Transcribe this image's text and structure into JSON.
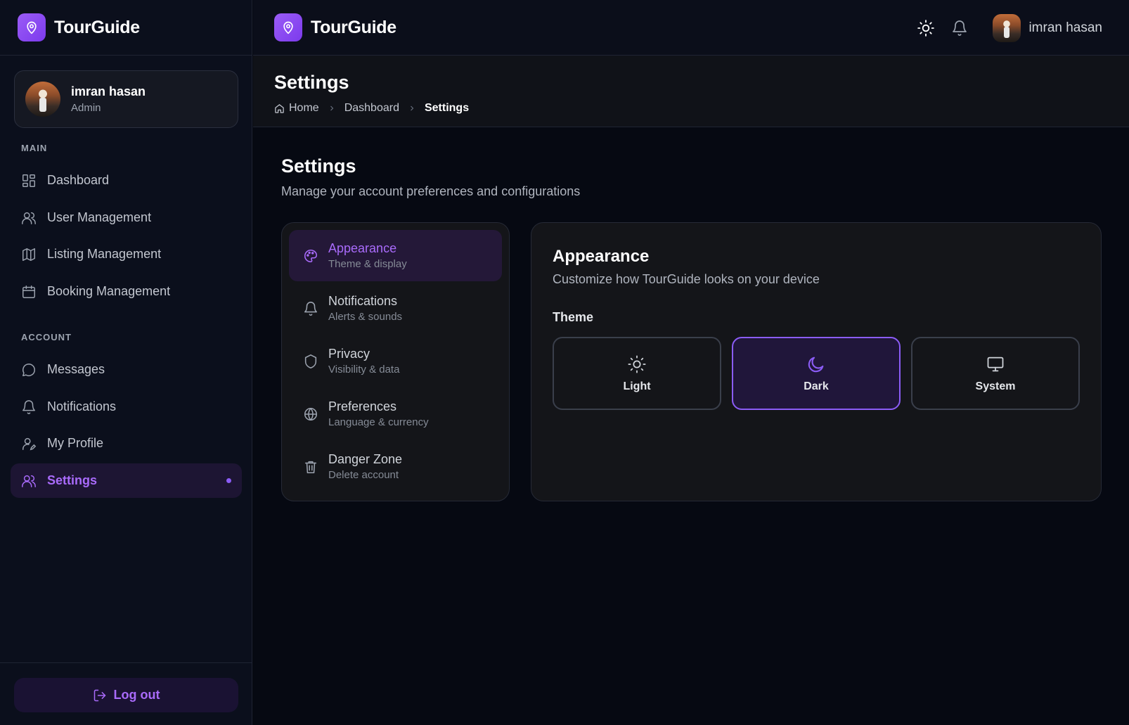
{
  "app": {
    "name": "TourGuide"
  },
  "user": {
    "name": "imran hasan",
    "role": "Admin"
  },
  "sidebar": {
    "main_label": "MAIN",
    "main_items": [
      {
        "label": "Dashboard",
        "icon": "grid-icon"
      },
      {
        "label": "User Management",
        "icon": "users-icon"
      },
      {
        "label": "Listing Management",
        "icon": "map-icon"
      },
      {
        "label": "Booking Management",
        "icon": "calendar-icon"
      }
    ],
    "account_label": "ACCOUNT",
    "account_items": [
      {
        "label": "Messages",
        "icon": "message-icon"
      },
      {
        "label": "Notifications",
        "icon": "bell-icon"
      },
      {
        "label": "My Profile",
        "icon": "user-edit-icon"
      },
      {
        "label": "Settings",
        "icon": "users-icon",
        "active": true
      }
    ],
    "logout_label": "Log out"
  },
  "header": {
    "title": "Settings",
    "breadcrumb": [
      "Home",
      "Dashboard",
      "Settings"
    ]
  },
  "main": {
    "title": "Settings",
    "subtitle": "Manage your account preferences and configurations"
  },
  "settings_nav": [
    {
      "title": "Appearance",
      "subtitle": "Theme & display",
      "icon": "palette-icon",
      "active": true
    },
    {
      "title": "Notifications",
      "subtitle": "Alerts & sounds",
      "icon": "bell-icon"
    },
    {
      "title": "Privacy",
      "subtitle": "Visibility & data",
      "icon": "shield-icon"
    },
    {
      "title": "Preferences",
      "subtitle": "Language & currency",
      "icon": "globe-icon"
    },
    {
      "title": "Danger Zone",
      "subtitle": "Delete account",
      "icon": "trash-icon"
    }
  ],
  "panel": {
    "title": "Appearance",
    "subtitle": "Customize how TourGuide looks on your device",
    "theme_label": "Theme",
    "themes": [
      {
        "label": "Light",
        "icon": "sun-icon"
      },
      {
        "label": "Dark",
        "icon": "moon-icon",
        "selected": true
      },
      {
        "label": "System",
        "icon": "monitor-icon"
      }
    ]
  },
  "colors": {
    "accent": "#8b5cf6",
    "accent_text": "#a96bfb",
    "background": "#060912",
    "sidebar": "#0b0f1c",
    "card": "#141519"
  }
}
